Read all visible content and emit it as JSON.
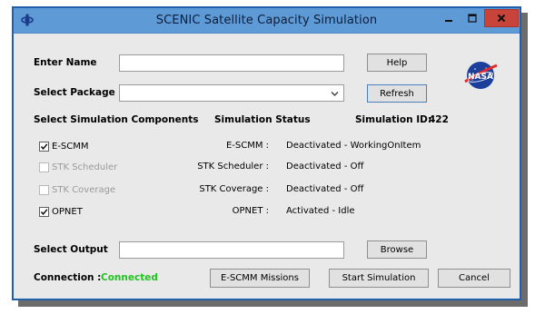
{
  "window": {
    "title": "SCENIC Satellite Capacity Simulation",
    "icons": {
      "app": "satellite-icon",
      "min": "minimize-icon",
      "max": "maximize-icon",
      "close": "close-icon"
    }
  },
  "form": {
    "name_label": "Enter Name",
    "name_value": "",
    "help_label": "Help",
    "package_label": "Select Package",
    "package_value": "",
    "refresh_label": "Refresh",
    "output_label": "Select Output",
    "output_value": "",
    "browse_label": "Browse"
  },
  "headers": {
    "components": "Select Simulation Components",
    "status": "Simulation Status",
    "sim_id_label": "Simulation ID:",
    "sim_id_value": "422"
  },
  "components": [
    {
      "label": "E-SCMM",
      "checked": true,
      "enabled": true,
      "status_name": "E-SCMM :",
      "status_value": "Deactivated - WorkingOnItem"
    },
    {
      "label": "STK Scheduler",
      "checked": false,
      "enabled": false,
      "status_name": "STK Scheduler :",
      "status_value": "Deactivated - Off"
    },
    {
      "label": "STK Coverage",
      "checked": false,
      "enabled": false,
      "status_name": "STK Coverage :",
      "status_value": "Deactivated - Off"
    },
    {
      "label": "OPNET",
      "checked": true,
      "enabled": true,
      "status_name": "OPNET :",
      "status_value": "Activated - Idle"
    }
  ],
  "connection": {
    "label": "Connection :",
    "value": "Connected",
    "color": "#22c322"
  },
  "actions": {
    "missions": "E-SCMM Missions",
    "start": "Start Simulation",
    "cancel": "Cancel"
  },
  "logo": {
    "text": "NASA",
    "icon": "nasa-logo"
  },
  "colors": {
    "title_bar": "#5d9ad6",
    "close_button": "#c8433a",
    "window_bg": "#e9e9ea"
  }
}
